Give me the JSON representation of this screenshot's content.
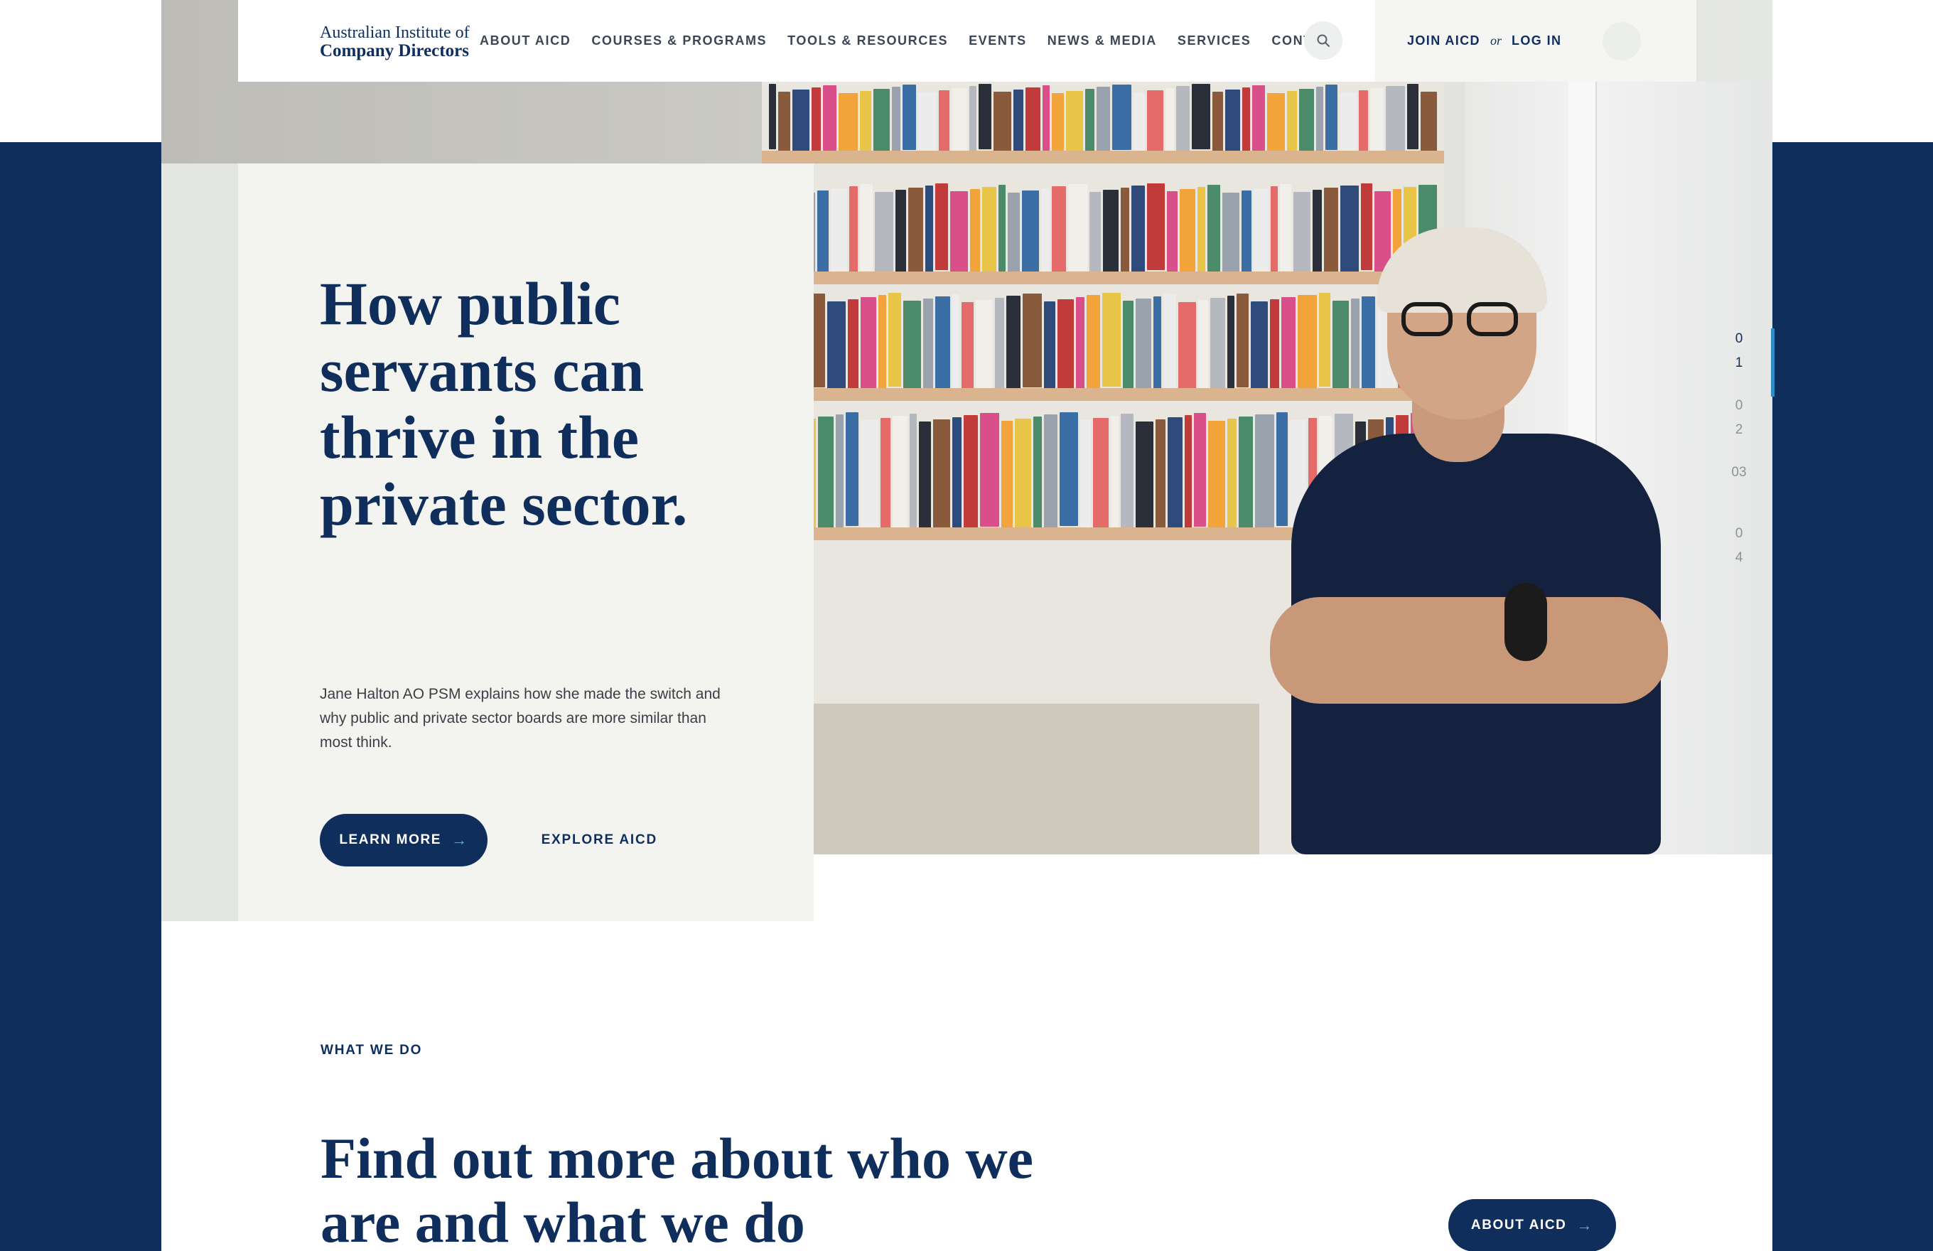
{
  "brand": {
    "logo_line1": "Australian Institute of",
    "logo_line2": "Company Directors",
    "navy": "#0f2e5c",
    "accent": "#4fb5e6"
  },
  "nav": {
    "links": [
      "ABOUT AICD",
      "COURSES & PROGRAMS",
      "TOOLS & RESOURCES",
      "EVENTS",
      "NEWS & MEDIA",
      "SERVICES",
      "CONTACT"
    ],
    "search_icon": "search-icon",
    "join_label": "JOIN AICD",
    "or_label": "or",
    "login_label": "LOG IN",
    "avatar_icon": "user-avatar"
  },
  "hero": {
    "title": "How public servants can thrive in the private sector.",
    "description": "Jane Halton AO PSM explains how she made the switch and why public and private sector boards are more similar than most think.",
    "learn_more_label": "LEARN MORE",
    "explore_label": "EXPLORE AICD",
    "arrow_icon": "arrow-right-icon"
  },
  "slides": {
    "items": [
      "0\n1",
      "0\n2",
      "03",
      "0\n4"
    ],
    "active_index": 0
  },
  "what_we_do": {
    "label": "WHAT WE DO",
    "title": "Find out more about who we are and what we do",
    "button_label": "ABOUT AICD"
  }
}
